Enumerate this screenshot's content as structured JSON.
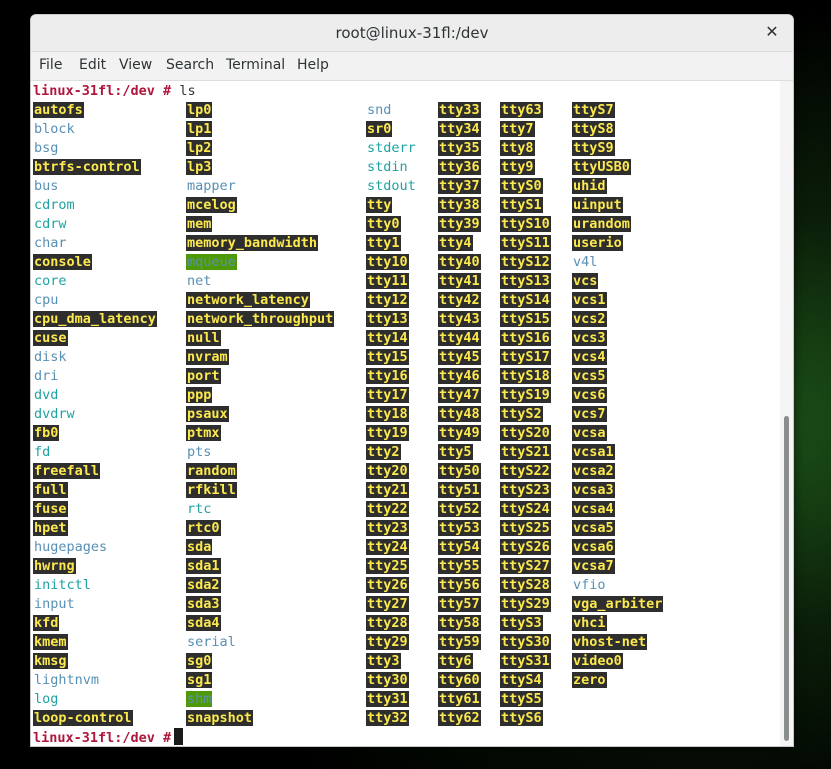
{
  "window": {
    "title": "root@linux-31fl:/dev",
    "close_glyph": "✕"
  },
  "menu": [
    "File",
    "Edit",
    "View",
    "Search",
    "Terminal",
    "Help"
  ],
  "terminal": {
    "prompt": "linux-31fl:/dev #",
    "command": "ls",
    "columns": [
      [
        {
          "name": "autofs",
          "type": "char"
        },
        {
          "name": "block",
          "type": "dir"
        },
        {
          "name": "bsg",
          "type": "dir"
        },
        {
          "name": "btrfs-control",
          "type": "char"
        },
        {
          "name": "bus",
          "type": "dir"
        },
        {
          "name": "cdrom",
          "type": "link"
        },
        {
          "name": "cdrw",
          "type": "link"
        },
        {
          "name": "char",
          "type": "dir"
        },
        {
          "name": "console",
          "type": "char"
        },
        {
          "name": "core",
          "type": "link"
        },
        {
          "name": "cpu",
          "type": "dir"
        },
        {
          "name": "cpu_dma_latency",
          "type": "char"
        },
        {
          "name": "cuse",
          "type": "char"
        },
        {
          "name": "disk",
          "type": "dir"
        },
        {
          "name": "dri",
          "type": "dir"
        },
        {
          "name": "dvd",
          "type": "link"
        },
        {
          "name": "dvdrw",
          "type": "link"
        },
        {
          "name": "fb0",
          "type": "char"
        },
        {
          "name": "fd",
          "type": "link"
        },
        {
          "name": "freefall",
          "type": "char"
        },
        {
          "name": "full",
          "type": "char"
        },
        {
          "name": "fuse",
          "type": "char"
        },
        {
          "name": "hpet",
          "type": "char"
        },
        {
          "name": "hugepages",
          "type": "dir"
        },
        {
          "name": "hwrng",
          "type": "char"
        },
        {
          "name": "initctl",
          "type": "link"
        },
        {
          "name": "input",
          "type": "dir"
        },
        {
          "name": "kfd",
          "type": "char"
        },
        {
          "name": "kmem",
          "type": "char"
        },
        {
          "name": "kmsg",
          "type": "char"
        },
        {
          "name": "lightnvm",
          "type": "dir"
        },
        {
          "name": "log",
          "type": "link"
        },
        {
          "name": "loop-control",
          "type": "char"
        }
      ],
      [
        {
          "name": "lp0",
          "type": "char"
        },
        {
          "name": "lp1",
          "type": "char"
        },
        {
          "name": "lp2",
          "type": "char"
        },
        {
          "name": "lp3",
          "type": "char"
        },
        {
          "name": "mapper",
          "type": "dir"
        },
        {
          "name": "mcelog",
          "type": "char"
        },
        {
          "name": "mem",
          "type": "char"
        },
        {
          "name": "memory_bandwidth",
          "type": "char"
        },
        {
          "name": "mqueue",
          "type": "sticky"
        },
        {
          "name": "net",
          "type": "dir"
        },
        {
          "name": "network_latency",
          "type": "char"
        },
        {
          "name": "network_throughput",
          "type": "char"
        },
        {
          "name": "null",
          "type": "char"
        },
        {
          "name": "nvram",
          "type": "char"
        },
        {
          "name": "port",
          "type": "char"
        },
        {
          "name": "ppp",
          "type": "char"
        },
        {
          "name": "psaux",
          "type": "char"
        },
        {
          "name": "ptmx",
          "type": "char"
        },
        {
          "name": "pts",
          "type": "dir"
        },
        {
          "name": "random",
          "type": "char"
        },
        {
          "name": "rfkill",
          "type": "char"
        },
        {
          "name": "rtc",
          "type": "link"
        },
        {
          "name": "rtc0",
          "type": "char"
        },
        {
          "name": "sda",
          "type": "block"
        },
        {
          "name": "sda1",
          "type": "block"
        },
        {
          "name": "sda2",
          "type": "block"
        },
        {
          "name": "sda3",
          "type": "block"
        },
        {
          "name": "sda4",
          "type": "block"
        },
        {
          "name": "serial",
          "type": "dir"
        },
        {
          "name": "sg0",
          "type": "char"
        },
        {
          "name": "sg1",
          "type": "char"
        },
        {
          "name": "shm",
          "type": "sticky"
        },
        {
          "name": "snapshot",
          "type": "char"
        }
      ],
      [
        {
          "name": "snd",
          "type": "dir"
        },
        {
          "name": "sr0",
          "type": "block"
        },
        {
          "name": "stderr",
          "type": "link"
        },
        {
          "name": "stdin",
          "type": "link"
        },
        {
          "name": "stdout",
          "type": "link"
        },
        {
          "name": "tty",
          "type": "char"
        },
        {
          "name": "tty0",
          "type": "char"
        },
        {
          "name": "tty1",
          "type": "char"
        },
        {
          "name": "tty10",
          "type": "char"
        },
        {
          "name": "tty11",
          "type": "char"
        },
        {
          "name": "tty12",
          "type": "char"
        },
        {
          "name": "tty13",
          "type": "char"
        },
        {
          "name": "tty14",
          "type": "char"
        },
        {
          "name": "tty15",
          "type": "char"
        },
        {
          "name": "tty16",
          "type": "char"
        },
        {
          "name": "tty17",
          "type": "char"
        },
        {
          "name": "tty18",
          "type": "char"
        },
        {
          "name": "tty19",
          "type": "char"
        },
        {
          "name": "tty2",
          "type": "char"
        },
        {
          "name": "tty20",
          "type": "char"
        },
        {
          "name": "tty21",
          "type": "char"
        },
        {
          "name": "tty22",
          "type": "char"
        },
        {
          "name": "tty23",
          "type": "char"
        },
        {
          "name": "tty24",
          "type": "char"
        },
        {
          "name": "tty25",
          "type": "char"
        },
        {
          "name": "tty26",
          "type": "char"
        },
        {
          "name": "tty27",
          "type": "char"
        },
        {
          "name": "tty28",
          "type": "char"
        },
        {
          "name": "tty29",
          "type": "char"
        },
        {
          "name": "tty3",
          "type": "char"
        },
        {
          "name": "tty30",
          "type": "char"
        },
        {
          "name": "tty31",
          "type": "char"
        },
        {
          "name": "tty32",
          "type": "char"
        }
      ],
      [
        {
          "name": "tty33",
          "type": "char"
        },
        {
          "name": "tty34",
          "type": "char"
        },
        {
          "name": "tty35",
          "type": "char"
        },
        {
          "name": "tty36",
          "type": "char"
        },
        {
          "name": "tty37",
          "type": "char"
        },
        {
          "name": "tty38",
          "type": "char"
        },
        {
          "name": "tty39",
          "type": "char"
        },
        {
          "name": "tty4",
          "type": "char"
        },
        {
          "name": "tty40",
          "type": "char"
        },
        {
          "name": "tty41",
          "type": "char"
        },
        {
          "name": "tty42",
          "type": "char"
        },
        {
          "name": "tty43",
          "type": "char"
        },
        {
          "name": "tty44",
          "type": "char"
        },
        {
          "name": "tty45",
          "type": "char"
        },
        {
          "name": "tty46",
          "type": "char"
        },
        {
          "name": "tty47",
          "type": "char"
        },
        {
          "name": "tty48",
          "type": "char"
        },
        {
          "name": "tty49",
          "type": "char"
        },
        {
          "name": "tty5",
          "type": "char"
        },
        {
          "name": "tty50",
          "type": "char"
        },
        {
          "name": "tty51",
          "type": "char"
        },
        {
          "name": "tty52",
          "type": "char"
        },
        {
          "name": "tty53",
          "type": "char"
        },
        {
          "name": "tty54",
          "type": "char"
        },
        {
          "name": "tty55",
          "type": "char"
        },
        {
          "name": "tty56",
          "type": "char"
        },
        {
          "name": "tty57",
          "type": "char"
        },
        {
          "name": "tty58",
          "type": "char"
        },
        {
          "name": "tty59",
          "type": "char"
        },
        {
          "name": "tty6",
          "type": "char"
        },
        {
          "name": "tty60",
          "type": "char"
        },
        {
          "name": "tty61",
          "type": "char"
        },
        {
          "name": "tty62",
          "type": "char"
        }
      ],
      [
        {
          "name": "tty63",
          "type": "char"
        },
        {
          "name": "tty7",
          "type": "char"
        },
        {
          "name": "tty8",
          "type": "char"
        },
        {
          "name": "tty9",
          "type": "char"
        },
        {
          "name": "ttyS0",
          "type": "char"
        },
        {
          "name": "ttyS1",
          "type": "char"
        },
        {
          "name": "ttyS10",
          "type": "char"
        },
        {
          "name": "ttyS11",
          "type": "char"
        },
        {
          "name": "ttyS12",
          "type": "char"
        },
        {
          "name": "ttyS13",
          "type": "char"
        },
        {
          "name": "ttyS14",
          "type": "char"
        },
        {
          "name": "ttyS15",
          "type": "char"
        },
        {
          "name": "ttyS16",
          "type": "char"
        },
        {
          "name": "ttyS17",
          "type": "char"
        },
        {
          "name": "ttyS18",
          "type": "char"
        },
        {
          "name": "ttyS19",
          "type": "char"
        },
        {
          "name": "ttyS2",
          "type": "char"
        },
        {
          "name": "ttyS20",
          "type": "char"
        },
        {
          "name": "ttyS21",
          "type": "char"
        },
        {
          "name": "ttyS22",
          "type": "char"
        },
        {
          "name": "ttyS23",
          "type": "char"
        },
        {
          "name": "ttyS24",
          "type": "char"
        },
        {
          "name": "ttyS25",
          "type": "char"
        },
        {
          "name": "ttyS26",
          "type": "char"
        },
        {
          "name": "ttyS27",
          "type": "char"
        },
        {
          "name": "ttyS28",
          "type": "char"
        },
        {
          "name": "ttyS29",
          "type": "char"
        },
        {
          "name": "ttyS3",
          "type": "char"
        },
        {
          "name": "ttyS30",
          "type": "char"
        },
        {
          "name": "ttyS31",
          "type": "char"
        },
        {
          "name": "ttyS4",
          "type": "char"
        },
        {
          "name": "ttyS5",
          "type": "char"
        },
        {
          "name": "ttyS6",
          "type": "char"
        }
      ],
      [
        {
          "name": "ttyS7",
          "type": "char"
        },
        {
          "name": "ttyS8",
          "type": "char"
        },
        {
          "name": "ttyS9",
          "type": "char"
        },
        {
          "name": "ttyUSB0",
          "type": "char"
        },
        {
          "name": "uhid",
          "type": "char"
        },
        {
          "name": "uinput",
          "type": "char"
        },
        {
          "name": "urandom",
          "type": "char"
        },
        {
          "name": "userio",
          "type": "char"
        },
        {
          "name": "v4l",
          "type": "dir"
        },
        {
          "name": "vcs",
          "type": "char"
        },
        {
          "name": "vcs1",
          "type": "char"
        },
        {
          "name": "vcs2",
          "type": "char"
        },
        {
          "name": "vcs3",
          "type": "char"
        },
        {
          "name": "vcs4",
          "type": "char"
        },
        {
          "name": "vcs5",
          "type": "char"
        },
        {
          "name": "vcs6",
          "type": "char"
        },
        {
          "name": "vcs7",
          "type": "char"
        },
        {
          "name": "vcsa",
          "type": "char"
        },
        {
          "name": "vcsa1",
          "type": "char"
        },
        {
          "name": "vcsa2",
          "type": "char"
        },
        {
          "name": "vcsa3",
          "type": "char"
        },
        {
          "name": "vcsa4",
          "type": "char"
        },
        {
          "name": "vcsa5",
          "type": "char"
        },
        {
          "name": "vcsa6",
          "type": "char"
        },
        {
          "name": "vcsa7",
          "type": "char"
        },
        {
          "name": "vfio",
          "type": "dir"
        },
        {
          "name": "vga_arbiter",
          "type": "char"
        },
        {
          "name": "vhci",
          "type": "char"
        },
        {
          "name": "vhost-net",
          "type": "char"
        },
        {
          "name": "video0",
          "type": "char"
        },
        {
          "name": "zero",
          "type": "char"
        }
      ]
    ]
  },
  "colors": {
    "prompt": "#b0153b",
    "device_bg": "#2e2e2e",
    "device_fg": "#fce94f",
    "directory": "#5890b4",
    "symlink": "#20a2a2",
    "sticky_bg": "#4e9a06"
  }
}
